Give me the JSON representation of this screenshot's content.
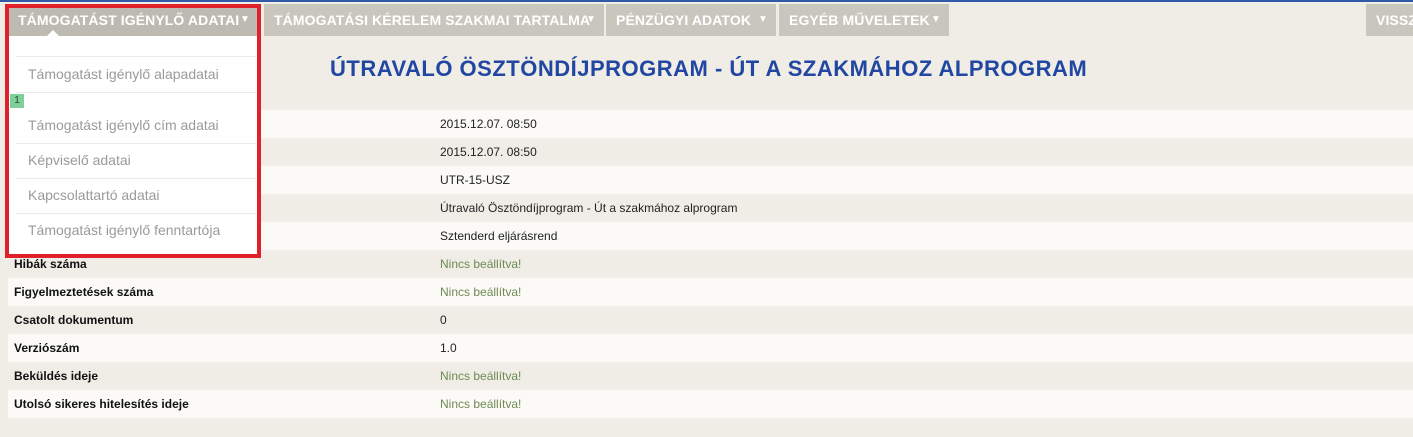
{
  "menu": {
    "items": [
      {
        "label": "TÁMOGATÁST IGÉNYLŐ ADATAI"
      },
      {
        "label": "TÁMOGATÁSI KÉRELEM SZAKMAI TARTALMA"
      },
      {
        "label": "PÉNZÜGYI ADATOK"
      },
      {
        "label": "EGYÉB MŰVELETEK"
      },
      {
        "label": "VISSZ"
      }
    ]
  },
  "dropdown": {
    "badge": "1",
    "items": [
      "Támogatást igénylő alapadatai",
      "Támogatást igénylő cím adatai",
      "Képviselő adatai",
      "Kapcsolattartó adatai",
      "Támogatást igénylő fenntartója"
    ]
  },
  "page": {
    "title": "ÚTRAVALÓ ÖSZTÖNDÍJPROGRAM - ÚT A SZAKMÁHOZ ALPROGRAM"
  },
  "table": {
    "rows": [
      {
        "label": "",
        "value": "2015.12.07. 08:50"
      },
      {
        "label": "",
        "value": "2015.12.07. 08:50"
      },
      {
        "label": "",
        "value": "UTR-15-USZ"
      },
      {
        "label": "",
        "value": "Útravaló Ösztöndíjprogram - Út a szakmához alprogram"
      },
      {
        "label": "",
        "value": "Sztenderd eljárásrend"
      },
      {
        "label": "Hibák száma",
        "value": "Nincs beállítva!"
      },
      {
        "label": "Figyelmeztetések száma",
        "value": "Nincs beállítva!"
      },
      {
        "label": "Csatolt dokumentum",
        "value": "0"
      },
      {
        "label": "Verziószám",
        "value": "1.0"
      },
      {
        "label": "Beküldés ideje",
        "value": "Nincs beállítva!"
      },
      {
        "label": "Utolsó sikeres hitelesítés ideje",
        "value": "Nincs beállítva!"
      }
    ]
  },
  "colors": {
    "accent": "#2147a3",
    "highlight": "#e0202a",
    "menu_bg": "#c9c6bd",
    "warning_text": "#6f8a55"
  }
}
